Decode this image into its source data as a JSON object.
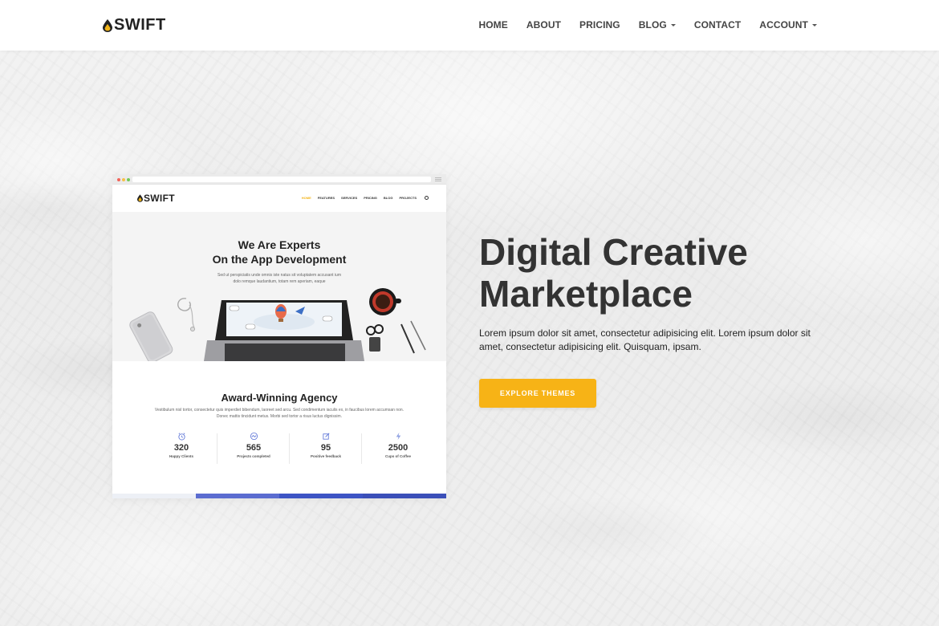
{
  "brand": {
    "name": "SWIFT",
    "logo_icon": "drop-icon",
    "accent": "#f7b316",
    "drop_color": "#f1b418"
  },
  "nav": {
    "items": [
      {
        "label": "HOME",
        "dropdown": false
      },
      {
        "label": "ABOUT",
        "dropdown": false
      },
      {
        "label": "PRICING",
        "dropdown": false
      },
      {
        "label": "BLOG",
        "dropdown": true
      },
      {
        "label": "CONTACT",
        "dropdown": false
      },
      {
        "label": "ACCOUNT",
        "dropdown": true
      }
    ]
  },
  "hero": {
    "title_line1": "Digital Creative",
    "title_line2": "Marketplace",
    "text": "Lorem ipsum dolor sit amet, consectetur adipisicing elit. Lorem ipsum dolor sit amet, consectetur adipisicing elit. Quisquam, ipsam.",
    "button_label": "EXPLORE THEMES"
  },
  "mockup": {
    "brand": "SWIFT",
    "nav_links": [
      "HOME",
      "FEATURES",
      "SERVICES",
      "PRICING",
      "BLOG",
      "PROJECTS"
    ],
    "active_link": "HOME",
    "headline_line1": "We Are Experts",
    "headline_line2": "On the App Development",
    "subtext": "Sed ut perspiciatis unde omnis iste natus sit voluptatem accusant ium dolo remque laudantium, totam rem aperiam, eaque",
    "section_title": "Award-Winning Agency",
    "section_text": "Vestibulum nisl tortor, consectetur quis imperdiet bibendum, laoreet sed arcu. Sed condimentum iaculis ex, in faucibus lorem accumsan non. Donec mattis tincidunt metus. Morbi sed tortor a risus luctus dignissim.",
    "stats": [
      {
        "icon": "alarm-clock-icon",
        "value": "320",
        "label": "Happy Clients"
      },
      {
        "icon": "gauge-icon",
        "value": "565",
        "label": "Projects completed"
      },
      {
        "icon": "edit-icon",
        "value": "95",
        "label": "Positive feedback"
      },
      {
        "icon": "lightning-icon",
        "value": "2500",
        "label": "Cups of Coffee"
      }
    ],
    "bottom_bar_colors": [
      "#edf0f6",
      "#5b6cd0",
      "#3d54c4",
      "#3b4fb8"
    ]
  }
}
